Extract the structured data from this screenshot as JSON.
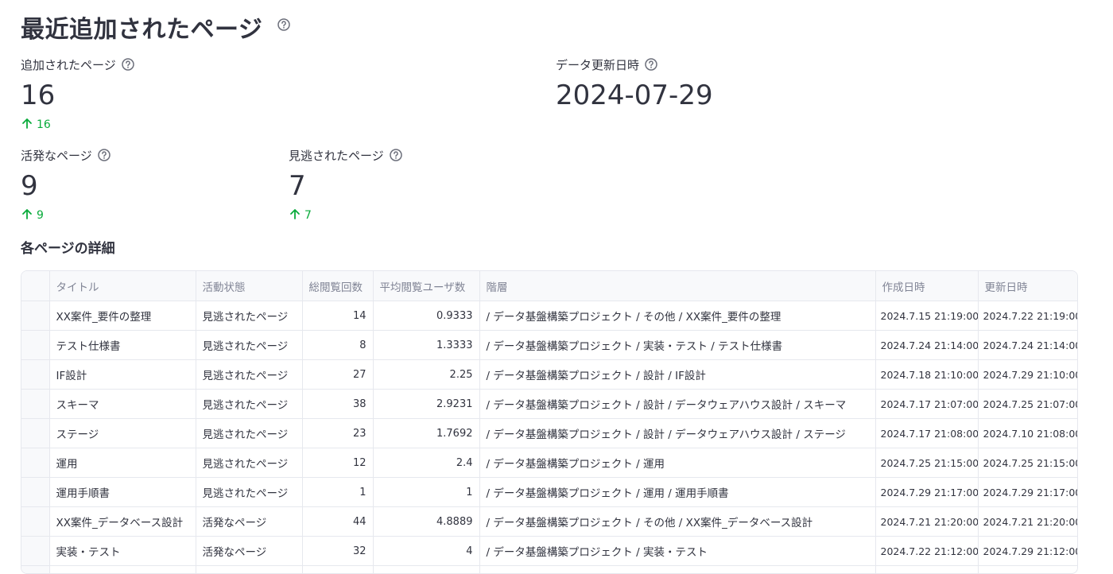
{
  "page": {
    "title": "最近追加されたページ"
  },
  "metrics": {
    "added": {
      "label": "追加されたページ",
      "value": "16",
      "delta": "16"
    },
    "updated": {
      "label": "データ更新日時",
      "value": "2024-07-29"
    },
    "active": {
      "label": "活発なページ",
      "value": "9",
      "delta": "9"
    },
    "missed": {
      "label": "見逃されたページ",
      "value": "7",
      "delta": "7"
    }
  },
  "colors": {
    "delta_positive": "#09ab3b",
    "text": "#31333f",
    "header_text": "#808495"
  },
  "details": {
    "title": "各ページの詳細",
    "columns": [
      "",
      "タイトル",
      "活動状態",
      "総閲覧回数",
      "平均閲覧ユーザ数",
      "階層",
      "作成日時",
      "更新日時"
    ],
    "rows": [
      [
        "",
        "XX案件_要件の整理",
        "見逃されたページ",
        "14",
        "0.9333",
        " / データ基盤構築プロジェクト / その他 / XX案件_要件の整理",
        "2024.7.15 21:19:00",
        "2024.7.22 21:19:00"
      ],
      [
        "",
        "テスト仕様書",
        "見逃されたページ",
        "8",
        "1.3333",
        " / データ基盤構築プロジェクト / 実装・テスト / テスト仕様書",
        "2024.7.24 21:14:00",
        "2024.7.24 21:14:00"
      ],
      [
        "",
        "IF設計",
        "見逃されたページ",
        "27",
        "2.25",
        " / データ基盤構築プロジェクト / 設計 / IF設計",
        "2024.7.18 21:10:00",
        "2024.7.29 21:10:00"
      ],
      [
        "",
        "スキーマ",
        "見逃されたページ",
        "38",
        "2.9231",
        " / データ基盤構築プロジェクト / 設計 / データウェアハウス設計 / スキーマ",
        "2024.7.17 21:07:00",
        "2024.7.25 21:07:00"
      ],
      [
        "",
        "ステージ",
        "見逃されたページ",
        "23",
        "1.7692",
        " / データ基盤構築プロジェクト / 設計 / データウェアハウス設計 / ステージ",
        "2024.7.17 21:08:00",
        "2024.7.10 21:08:00"
      ],
      [
        "",
        "運用",
        "見逃されたページ",
        "12",
        "2.4",
        " / データ基盤構築プロジェクト / 運用",
        "2024.7.25 21:15:00",
        "2024.7.25 21:15:00"
      ],
      [
        "",
        "運用手順書",
        "見逃されたページ",
        "1",
        "1",
        " / データ基盤構築プロジェクト / 運用 / 運用手順書",
        "2024.7.29 21:17:00",
        "2024.7.29 21:17:00"
      ],
      [
        "",
        "XX案件_データベース設計",
        "活発なページ",
        "44",
        "4.8889",
        " / データ基盤構築プロジェクト / その他 / XX案件_データベース設計",
        "2024.7.21 21:20:00",
        "2024.7.21 21:20:00"
      ],
      [
        "",
        "実装・テスト",
        "活発なページ",
        "32",
        "4",
        " / データ基盤構築プロジェクト / 実装・テスト",
        "2024.7.22 21:12:00",
        "2024.7.29 21:12:00"
      ],
      [
        "",
        "",
        "",
        "",
        "",
        "",
        "",
        ""
      ]
    ]
  }
}
